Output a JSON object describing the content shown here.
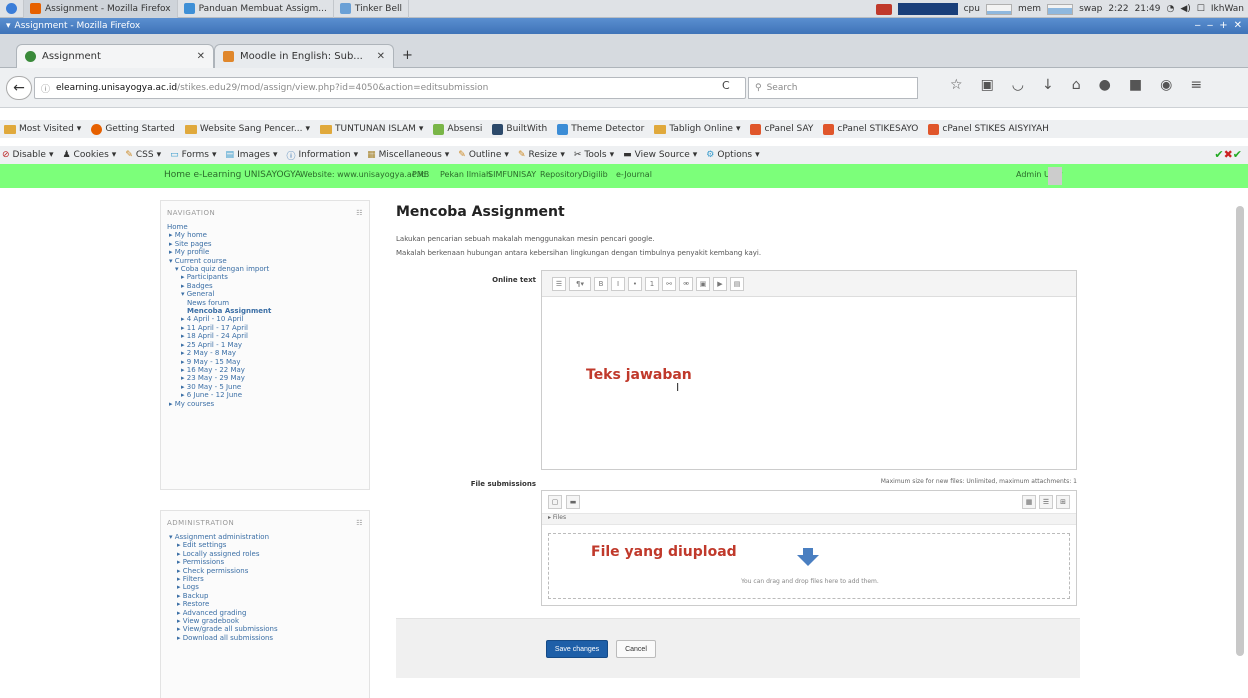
{
  "taskbar": {
    "apps": [
      {
        "label": "Assignment - Mozilla Firefox"
      },
      {
        "label": "Panduan Membuat Assigm..."
      },
      {
        "label": "Tinker Bell"
      }
    ],
    "tray": {
      "cpu": "cpu",
      "mem": "mem",
      "swap": "swap",
      "time1": "2:22",
      "time2": "21:49",
      "user": "IkhWan"
    }
  },
  "window": {
    "title": "Assignment - Mozilla Firefox"
  },
  "tabs": [
    {
      "label": "Assignment",
      "active": true
    },
    {
      "label": "Moodle in English: Sub...",
      "active": false
    }
  ],
  "navbar": {
    "url_domain": "elearning.unisayogya.ac.id",
    "url_rest": "/stikes.edu29/mod/assign/view.php?id=4050&action=editsubmission",
    "search_placeholder": "Search"
  },
  "bookmarks": [
    "Most Visited",
    "Getting Started",
    "Website Sang Pencer...",
    "TUNTUNAN ISLAM",
    "Absensi",
    "BuiltWith",
    "Theme Detector",
    "Tabligh Online",
    "cPanel SAY",
    "cPanel STIKESAYO",
    "cPanel STIKES AISYIYAH"
  ],
  "webdev": [
    "Disable",
    "Cookies",
    "CSS",
    "Forms",
    "Images",
    "Information",
    "Miscellaneous",
    "Outline",
    "Resize",
    "Tools",
    "View Source",
    "Options"
  ],
  "moodlebar": {
    "site": "Home e-Learning UNISAYOGYA",
    "links": [
      "Website: www.unisayogya.ac.id",
      "PMB",
      "Pekan Ilmiah",
      "SIMFUNISAY",
      "RepositoryDigilib",
      "e-Journal"
    ],
    "user": "Admin User"
  },
  "navigation": {
    "heading": "NAVIGATION",
    "items": [
      {
        "label": "Home",
        "current": false
      },
      {
        "label": "▸ My home",
        "current": false
      },
      {
        "label": "▸ Site pages",
        "current": false
      },
      {
        "label": "▸ My profile",
        "current": false
      },
      {
        "label": "▾ Current course",
        "current": false
      },
      {
        "label": "▾ Coba quiz dengan import",
        "current": false
      },
      {
        "label": "▸ Participants",
        "current": false
      },
      {
        "label": "▸ Badges",
        "current": false
      },
      {
        "label": "▾ General",
        "current": false
      },
      {
        "label": "News forum",
        "current": false
      },
      {
        "label": "Mencoba Assignment",
        "current": true
      },
      {
        "label": "▸ 4 April - 10 April",
        "current": false
      },
      {
        "label": "▸ 11 April - 17 April",
        "current": false
      },
      {
        "label": "▸ 18 April - 24 April",
        "current": false
      },
      {
        "label": "▸ 25 April - 1 May",
        "current": false
      },
      {
        "label": "▸ 2 May - 8 May",
        "current": false
      },
      {
        "label": "▸ 9 May - 15 May",
        "current": false
      },
      {
        "label": "▸ 16 May - 22 May",
        "current": false
      },
      {
        "label": "▸ 23 May - 29 May",
        "current": false
      },
      {
        "label": "▸ 30 May - 5 June",
        "current": false
      },
      {
        "label": "▸ 6 June - 12 June",
        "current": false
      },
      {
        "label": "▸ My courses",
        "current": false
      }
    ]
  },
  "administration": {
    "heading": "ADMINISTRATION",
    "items": [
      "▾ Assignment administration",
      "▸ Edit settings",
      "▸ Locally assigned roles",
      "▸ Permissions",
      "▸ Check permissions",
      "▸ Filters",
      "▸ Logs",
      "▸ Backup",
      "▸ Restore",
      "▸ Advanced grading",
      "▸ View gradebook",
      "▸ View/grade all submissions",
      "▸ Download all submissions"
    ]
  },
  "main": {
    "title": "Mencoba Assignment",
    "intro1": "Lakukan pencarian sebuah makalah menggunakan mesin pencari google.",
    "intro2": "Makalah berkenaan hubungan antara kebersihan lingkungan dengan timbulnya penyakit kembang kayi.",
    "online_text_label": "Online text",
    "annotation_text": "Teks jawaban",
    "file_label": "File submissions",
    "max_note": "Maximum size for new files: Unlimited, maximum attachments: 1",
    "folder_path": "Files",
    "annotation_file": "File yang diupload",
    "drop_hint": "You can drag and drop files here to add them.",
    "save_label": "Save changes",
    "cancel_label": "Cancel"
  },
  "colors": {
    "moodlebar": "#7cff7a",
    "primary_button": "#1e5fa8",
    "annotation": "#c0392b"
  }
}
